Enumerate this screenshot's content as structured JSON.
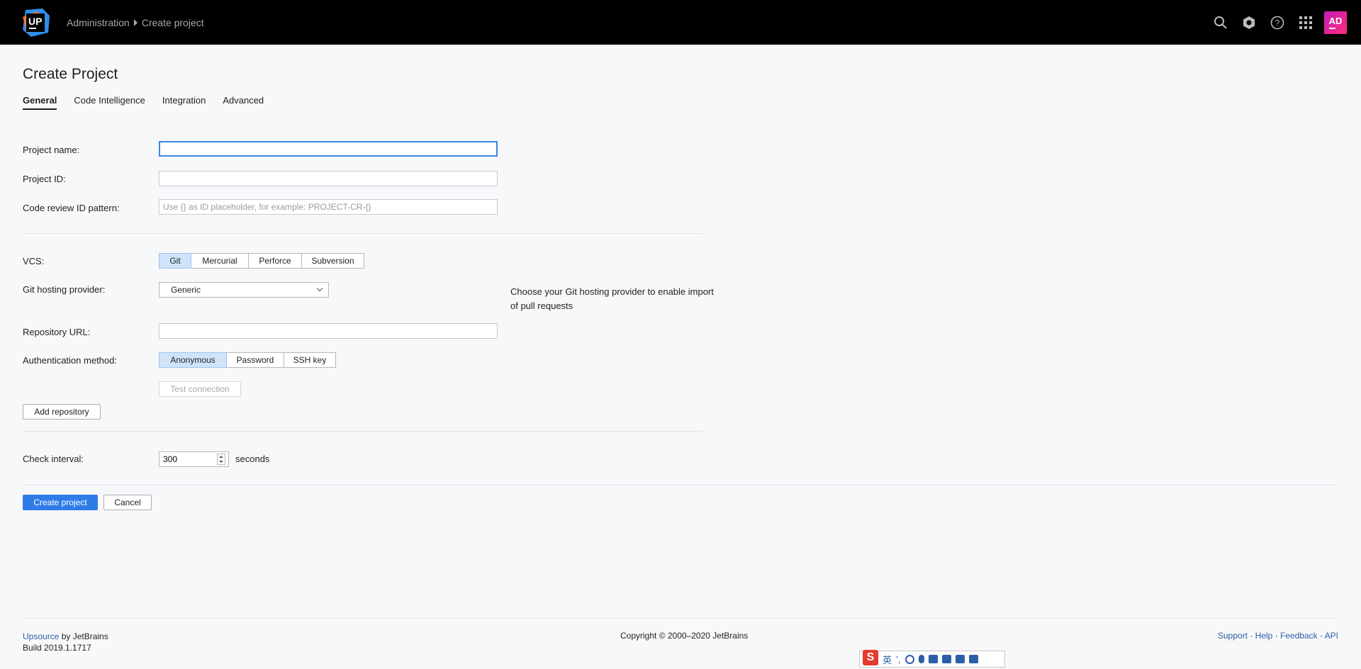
{
  "header": {
    "breadcrumb": [
      "Administration",
      "Create project"
    ],
    "logo_text": "UP",
    "avatar_initials": "AD",
    "icons": [
      "search-icon",
      "hexagon-icon",
      "help-icon",
      "apps-grid-icon"
    ]
  },
  "page": {
    "title": "Create Project",
    "tabs": [
      {
        "label": "General",
        "active": true
      },
      {
        "label": "Code Intelligence",
        "active": false
      },
      {
        "label": "Integration",
        "active": false
      },
      {
        "label": "Advanced",
        "active": false
      }
    ]
  },
  "form": {
    "project_name_label": "Project name:",
    "project_name_value": "",
    "project_id_label": "Project ID:",
    "project_id_value": "",
    "code_review_label": "Code review ID pattern:",
    "code_review_placeholder": "Use {} as ID placeholder, for example: PROJECT-CR-{}",
    "vcs_label": "VCS:",
    "vcs_options": [
      "Git",
      "Mercurial",
      "Perforce",
      "Subversion"
    ],
    "vcs_selected": "Git",
    "git_hosting_label": "Git hosting provider:",
    "git_hosting_value": "Generic",
    "git_hosting_hint": "Choose your Git hosting provider to enable import of pull requests",
    "repo_url_label": "Repository URL:",
    "repo_url_value": "",
    "auth_label": "Authentication method:",
    "auth_options": [
      "Anonymous",
      "Password",
      "SSH key"
    ],
    "auth_selected": "Anonymous",
    "test_connection_label": "Test connection",
    "add_repository_label": "Add repository",
    "check_interval_label": "Check interval:",
    "check_interval_value": "300",
    "check_interval_unit": "seconds",
    "create_label": "Create project",
    "cancel_label": "Cancel"
  },
  "footer": {
    "product_link": "Upsource",
    "by_text": " by JetBrains",
    "build": "Build 2019.1.1717",
    "copyright": "Copyright © 2000–2020 JetBrains",
    "links": [
      "Support",
      "Help",
      "Feedback",
      "API"
    ],
    "link_sep": " · "
  },
  "ime": {
    "badge": "S",
    "lang": "英",
    "punct": "’,"
  },
  "colors": {
    "accent": "#2f7ce8",
    "topbar": "#000000",
    "selected_segment": "#cfe4fb",
    "link": "#2c5fa3"
  }
}
